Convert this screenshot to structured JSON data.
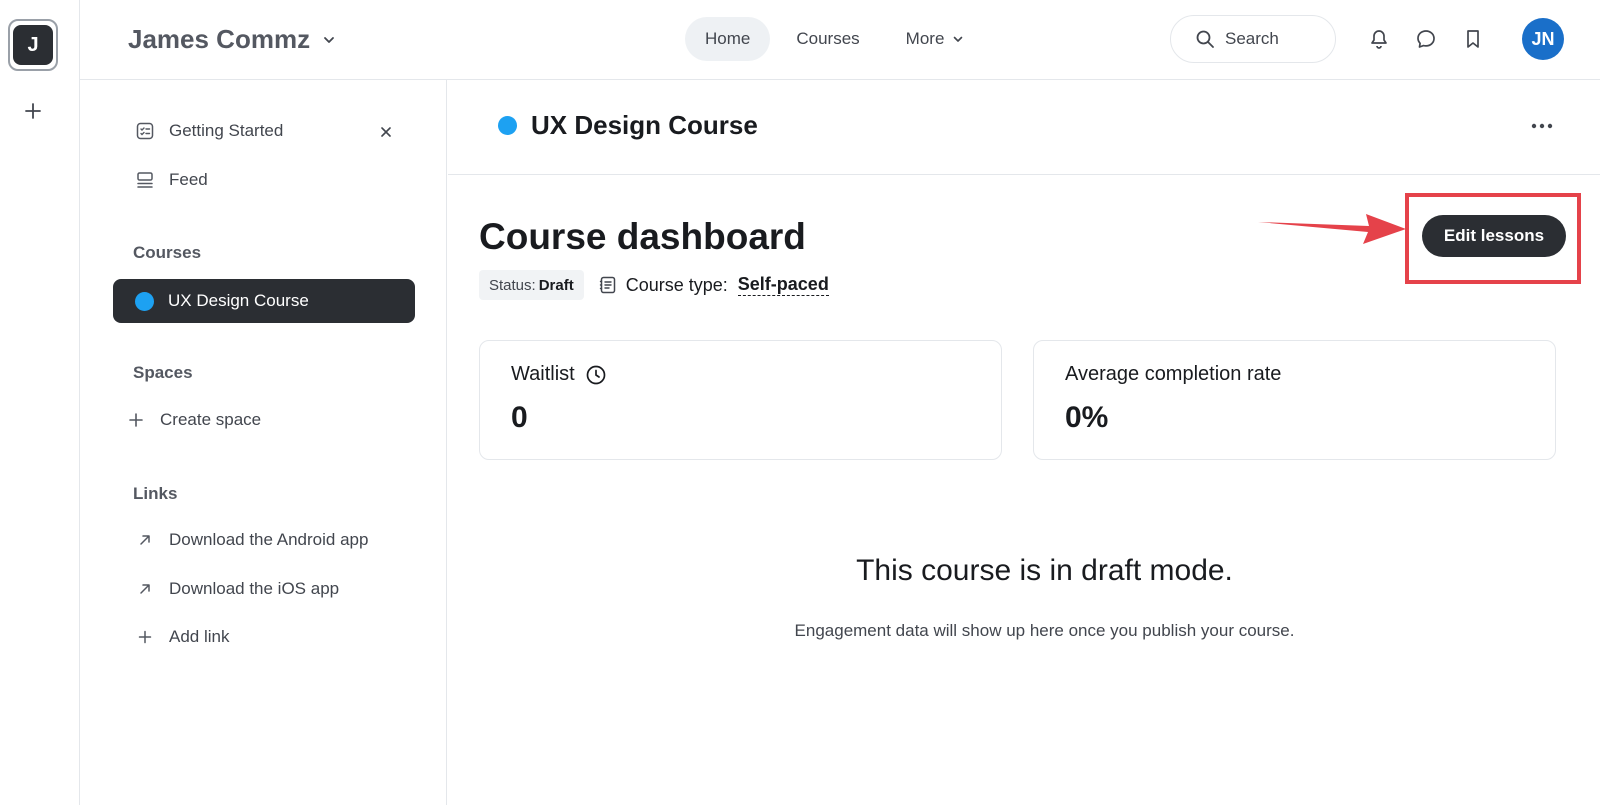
{
  "rail": {
    "community_initial": "J"
  },
  "header": {
    "community_name": "James Commz",
    "nav": [
      "Home",
      "Courses",
      "More"
    ],
    "search_label": "Search",
    "avatar_initials": "JN"
  },
  "sidebar": {
    "getting_started": "Getting Started",
    "feed": "Feed",
    "courses_label": "Courses",
    "course_item": "UX Design Course",
    "spaces_label": "Spaces",
    "create_space": "Create space",
    "links_label": "Links",
    "links": [
      "Download the Android app",
      "Download the iOS app",
      "Add link"
    ]
  },
  "main": {
    "course_title": "UX Design Course",
    "dashboard_title": "Course dashboard",
    "status_label": "Status:",
    "status_value": "Draft",
    "course_type_label": "Course type:",
    "course_type_value": "Self-paced",
    "edit_button": "Edit lessons",
    "cards": [
      {
        "label": "Waitlist",
        "value": "0"
      },
      {
        "label": "Average completion rate",
        "value": "0%"
      }
    ],
    "draft_title": "This course is in draft mode.",
    "draft_sub": "Engagement data will show up here once you publish your course."
  },
  "colors": {
    "accent_dark": "#2b2e33",
    "course_dot": "#1da1f2",
    "avatar": "#1a6fc9",
    "annotation_red": "#e5424a"
  }
}
